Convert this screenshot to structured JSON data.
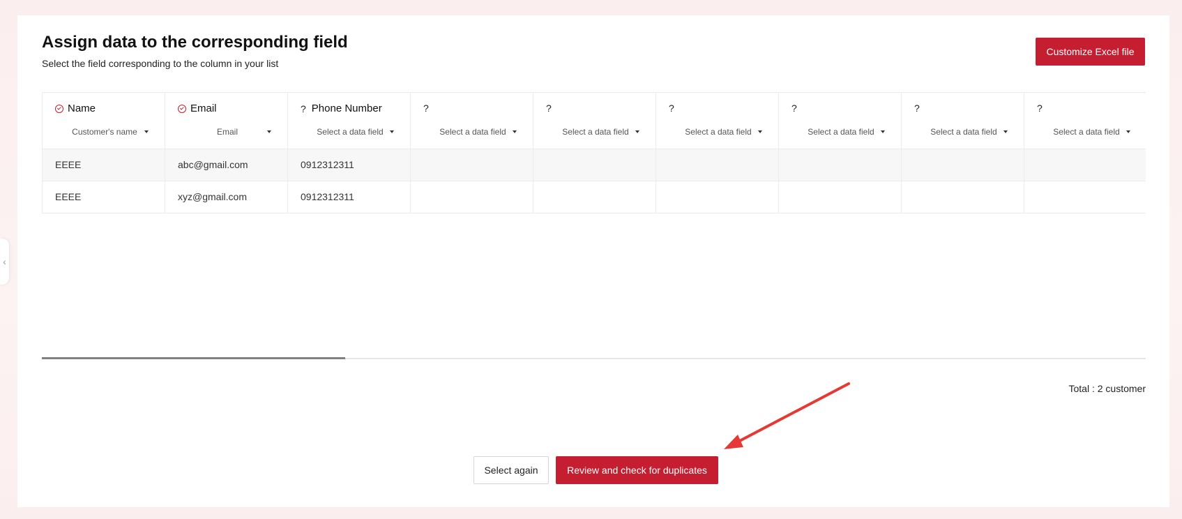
{
  "page": {
    "title": "Assign data to the corresponding field",
    "subtitle": "Select the field corresponding to the column in your list",
    "customize_button": "Customize Excel file"
  },
  "columns": [
    {
      "label": "Name",
      "mapped": true,
      "select_value": "Customer's name"
    },
    {
      "label": "Email",
      "mapped": true,
      "select_value": "Email"
    },
    {
      "label": "Phone Number",
      "mapped": false,
      "select_value": "Select a data field"
    },
    {
      "label": "",
      "mapped": false,
      "select_value": "Select a data field"
    },
    {
      "label": "",
      "mapped": false,
      "select_value": "Select a data field"
    },
    {
      "label": "",
      "mapped": false,
      "select_value": "Select a data field"
    },
    {
      "label": "",
      "mapped": false,
      "select_value": "Select a data field"
    },
    {
      "label": "",
      "mapped": false,
      "select_value": "Select a data field"
    },
    {
      "label": "",
      "mapped": false,
      "select_value": "Select a data field"
    }
  ],
  "unmapped_icon": "?",
  "rows": [
    [
      "EEEE",
      "abc@gmail.com",
      "0912312311",
      "",
      "",
      "",
      "",
      "",
      ""
    ],
    [
      "EEEE",
      "xyz@gmail.com",
      "0912312311",
      "",
      "",
      "",
      "",
      "",
      ""
    ]
  ],
  "total_text": "Total : 2 customer",
  "actions": {
    "select_again": "Select again",
    "review": "Review and check for duplicates"
  },
  "colors": {
    "accent": "#c41e30",
    "annotation_arrow": "#e53935"
  },
  "icons": {
    "mapped": "check-circle-icon",
    "unmapped": "question-mark-icon",
    "dropdown": "caret-down-icon",
    "side_handle": "chevron-left-icon"
  }
}
